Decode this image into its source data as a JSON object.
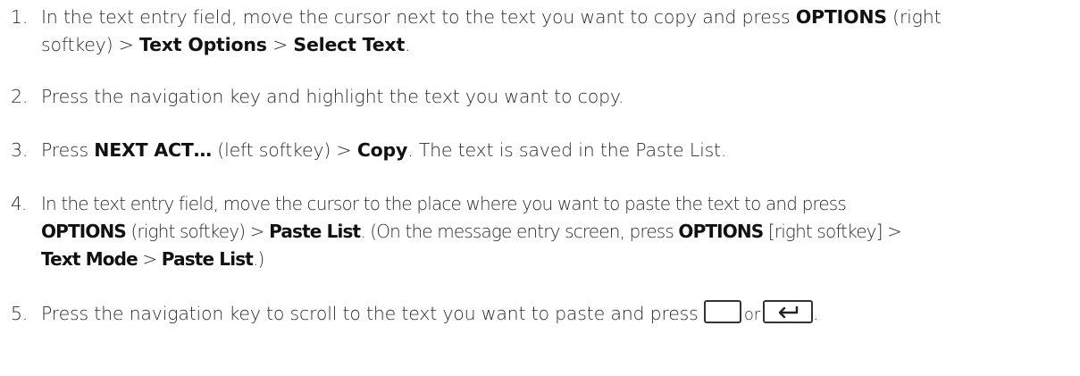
{
  "steps": [
    {
      "num": "1.",
      "l1_a": "In the text entry field, move the cursor next to the text you want to copy and press ",
      "l1_b": "OPTIONS",
      "l1_c": " (right",
      "l2_a": "softkey) > ",
      "l2_b": "Text Options",
      "l2_c": " > ",
      "l2_d": "Select Text",
      "l2_e": "."
    },
    {
      "num": "2.",
      "text": "Press the navigation key and highlight the text you want to copy."
    },
    {
      "num": "3.",
      "a": "Press ",
      "b": "NEXT ACT…",
      "c": " (left softkey) > ",
      "d": "Copy",
      "e": ". The text is saved in the Paste List."
    },
    {
      "num": "4.",
      "l1": "In the text entry field, move the cursor to the place where you want to paste the text to and press",
      "l2_a": "OPTIONS",
      "l2_b": " (right softkey) > ",
      "l2_c": "Paste List",
      "l2_d": ". (On the message entry screen, press ",
      "l2_e": "OPTIONS",
      "l2_f": " [right softkey] >",
      "l3_a": "Text Mode",
      "l3_b": " > ",
      "l3_c": "Paste List",
      "l3_d": ".)"
    },
    {
      "num": "5.",
      "a": "Press the navigation key to scroll to the text you want to paste and press ",
      "or": "or",
      "end": "."
    }
  ],
  "icons": {
    "center_key": "blank-key-icon",
    "enter_key": "enter-key-icon"
  }
}
